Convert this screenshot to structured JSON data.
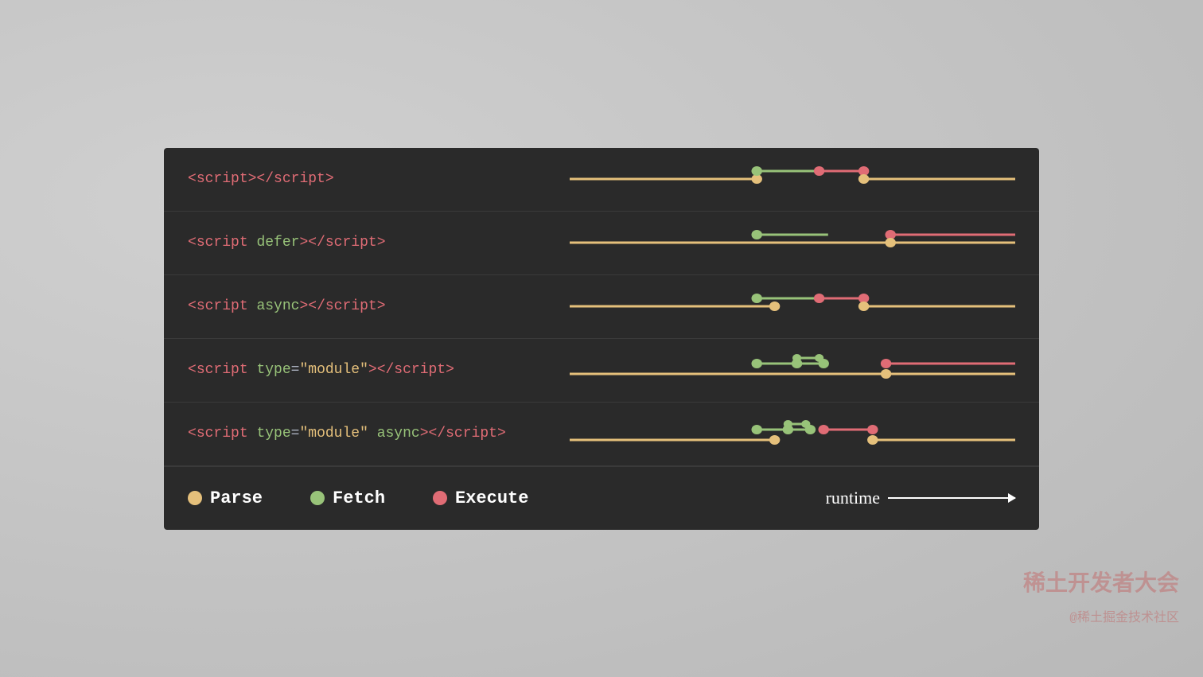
{
  "slide": {
    "rows": [
      {
        "id": "script-basic",
        "label_parts": [
          {
            "text": "<",
            "class": "code-tag-bracket"
          },
          {
            "text": "script",
            "class": "code-tag-name"
          },
          {
            "text": "><",
            "class": "code-tag-bracket"
          },
          {
            "text": "/script",
            "class": "code-tag-name"
          },
          {
            "text": ">",
            "class": "code-tag-bracket"
          }
        ]
      },
      {
        "id": "script-defer",
        "label_parts": [
          {
            "text": "<",
            "class": "code-tag-bracket"
          },
          {
            "text": "script ",
            "class": "code-tag-name"
          },
          {
            "text": "defer",
            "class": "code-attr"
          },
          {
            "text": "><",
            "class": "code-tag-bracket"
          },
          {
            "text": "/script",
            "class": "code-tag-name"
          },
          {
            "text": ">",
            "class": "code-tag-bracket"
          }
        ]
      },
      {
        "id": "script-async",
        "label_parts": [
          {
            "text": "<",
            "class": "code-tag-bracket"
          },
          {
            "text": "script ",
            "class": "code-tag-name"
          },
          {
            "text": "async",
            "class": "code-attr"
          },
          {
            "text": "><",
            "class": "code-tag-bracket"
          },
          {
            "text": "/script",
            "class": "code-tag-name"
          },
          {
            "text": ">",
            "class": "code-tag-bracket"
          }
        ]
      },
      {
        "id": "script-module",
        "label_parts": [
          {
            "text": "<",
            "class": "code-tag-bracket"
          },
          {
            "text": "script ",
            "class": "code-tag-name"
          },
          {
            "text": "type",
            "class": "code-attr"
          },
          {
            "text": "=",
            "class": "code-white"
          },
          {
            "text": "\"module\"",
            "class": "code-attr-val"
          },
          {
            "text": "><",
            "class": "code-tag-bracket"
          },
          {
            "text": "/script",
            "class": "code-tag-name"
          },
          {
            "text": ">",
            "class": "code-tag-bracket"
          }
        ]
      },
      {
        "id": "script-module-async",
        "label_parts": [
          {
            "text": "<",
            "class": "code-tag-bracket"
          },
          {
            "text": "script ",
            "class": "code-tag-name"
          },
          {
            "text": "type",
            "class": "code-attr"
          },
          {
            "text": "=",
            "class": "code-white"
          },
          {
            "text": "\"module\" ",
            "class": "code-attr-val"
          },
          {
            "text": "async",
            "class": "code-attr"
          },
          {
            "text": "><",
            "class": "code-tag-bracket"
          },
          {
            "text": "/script",
            "class": "code-tag-name"
          },
          {
            "text": ">",
            "class": "code-tag-bracket"
          }
        ]
      }
    ],
    "legend": {
      "parse_label": "Parse",
      "fetch_label": "Fetch",
      "execute_label": "Execute",
      "runtime_label": "runtime"
    },
    "watermark": {
      "line1": "稀土开发者大会",
      "line2": "@稀土掘金技术社区"
    }
  }
}
